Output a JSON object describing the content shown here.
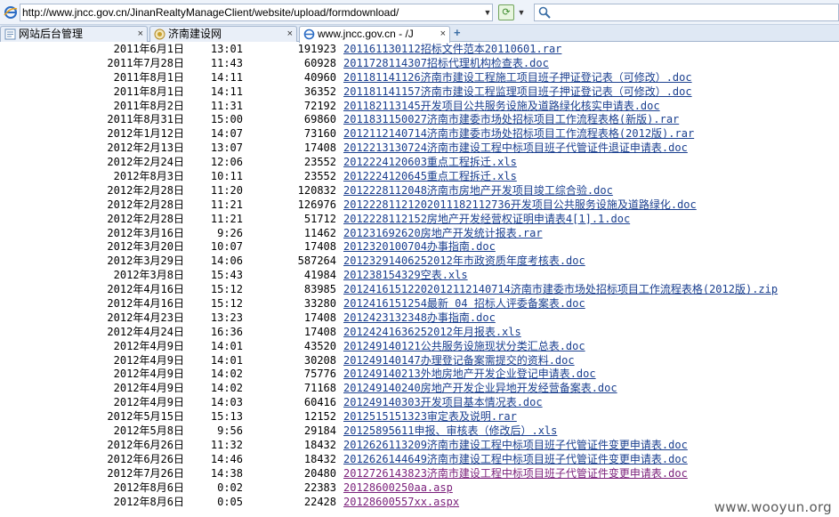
{
  "address_bar": {
    "url": "http://www.jncc.gov.cn/JinanRealtyManageClient/website/upload/formdownload/"
  },
  "tabs": [
    {
      "label": "网站后台管理",
      "close": "×"
    },
    {
      "label": "济南建设网",
      "close": "×"
    },
    {
      "label": "www.jncc.gov.cn - /J",
      "close": "×"
    }
  ],
  "new_tab_label": "+",
  "files": [
    {
      "date": "2011年6月1日",
      "time": "13:01",
      "size": "191923",
      "name": "201161130112招标文件范本20110601.rar"
    },
    {
      "date": "2011年7月28日",
      "time": "11:43",
      "size": "60928",
      "name": "2011728114307招标代理机构检查表.doc"
    },
    {
      "date": "2011年8月1日",
      "time": "14:11",
      "size": "40960",
      "name": "201181141126济南市建设工程施工项目班子押证登记表（可修改）.doc"
    },
    {
      "date": "2011年8月1日",
      "time": "14:11",
      "size": "36352",
      "name": "201181141157济南市建设工程监理项目班子押证登记表（可修改）.doc"
    },
    {
      "date": "2011年8月2日",
      "time": "11:31",
      "size": "72192",
      "name": "201182113145开发项目公共服务设施及道路绿化核实申请表.doc"
    },
    {
      "date": "2011年8月31日",
      "time": "15:00",
      "size": "69860",
      "name": "201183115002​7济南市建委市场处招标项目工作流程表格(新版).rar"
    },
    {
      "date": "2012年1月12日",
      "time": "14:07",
      "size": "73160",
      "name": "201211214071​4济南市建委市场处招标项目工作流程表格(2012版).rar"
    },
    {
      "date": "2012年2月13日",
      "time": "13:07",
      "size": "17408",
      "name": "2012213130724济南市建设工程中标项目班子代管证件退证申请表.doc"
    },
    {
      "date": "2012年2月24日",
      "time": "12:06",
      "size": "23552",
      "name": "2012224120603重点工程拆迁.xls"
    },
    {
      "date": "2012年8月3日",
      "time": "10:11",
      "size": "23552",
      "name": "2012224120645重点工程拆迁.xls"
    },
    {
      "date": "2012年2月28日",
      "time": "11:20",
      "size": "120832",
      "name": "2012228112048济南市房地产开发项目竣工综合验.doc"
    },
    {
      "date": "2012年2月28日",
      "time": "11:21",
      "size": "126976",
      "name": "201222811212020111821127​36开发项目公共服务设施及道路绿化.doc"
    },
    {
      "date": "2012年2月28日",
      "time": "11:21",
      "size": "51712",
      "name": "2012228112152房地产开发经营权证明申请表4[1].1.doc"
    },
    {
      "date": "2012年3月16日",
      "time": "9:26",
      "size": "11462",
      "name": "20123169262​0房地产开发统计报表.rar"
    },
    {
      "date": "2012年3月20日",
      "time": "10:07",
      "size": "17408",
      "name": "2012320100704办事指南.doc"
    },
    {
      "date": "2012年3月29日",
      "time": "14:06",
      "size": "587264",
      "name": "20123291406252012年市政资质年度考核表.doc"
    },
    {
      "date": "2012年3月8日",
      "time": "15:43",
      "size": "41984",
      "name": "20123815432​9空表.xls"
    },
    {
      "date": "2012年4月16日",
      "time": "15:12",
      "size": "83985",
      "name": "2012416151220201211214071​4济南市建委市场处招标项目工作流程表格(2012版).zip"
    },
    {
      "date": "2012年4月16日",
      "time": "15:12",
      "size": "33280",
      "name": "2012416151254最新  04 招标人评委备案表.doc"
    },
    {
      "date": "2012年4月23日",
      "time": "13:23",
      "size": "17408",
      "name": "2012423132348办事指南.doc"
    },
    {
      "date": "2012年4月24日",
      "time": "16:36",
      "size": "17408",
      "name": "20124241636252012年月报表.xls"
    },
    {
      "date": "2012年4月9日",
      "time": "14:01",
      "size": "43520",
      "name": "201249140121公共服务设施现状分类汇总表.doc"
    },
    {
      "date": "2012年4月9日",
      "time": "14:01",
      "size": "30208",
      "name": "201249140147办理登记备案需提交的资料.doc"
    },
    {
      "date": "2012年4月9日",
      "time": "14:02",
      "size": "75776",
      "name": "201249140213外地房地产开发企业登记申请表.doc"
    },
    {
      "date": "2012年4月9日",
      "time": "14:02",
      "size": "71168",
      "name": "201249140240房地产开发企业异地开发经营备案表.doc"
    },
    {
      "date": "2012年4月9日",
      "time": "14:03",
      "size": "60416",
      "name": "201249140303开发项目基本情况表.doc"
    },
    {
      "date": "2012年5月15日",
      "time": "15:13",
      "size": "12152",
      "name": "2012515151323审定表及说明.rar"
    },
    {
      "date": "2012年5月8日",
      "time": "9:56",
      "size": "29184",
      "name": "20125895611申报、审核表（修改后）.xls"
    },
    {
      "date": "2012年6月26日",
      "time": "11:32",
      "size": "18432",
      "name": "2012626113209济南市建设工程中标项目班子代管证件变更申请表.doc"
    },
    {
      "date": "2012年6月26日",
      "time": "14:46",
      "size": "18432",
      "name": "2012626144649济南市建设工程中标项目班子代管证件变更申请表.doc"
    },
    {
      "date": "2012年7月26日",
      "time": "14:38",
      "size": "20480",
      "name": "2012726143823济南市建设工程中标项目班子代管证件变更申请表.doc",
      "visited": true
    },
    {
      "date": "2012年8月6日",
      "time": "0:02",
      "size": "22383",
      "name": "20128600250aa.asp",
      "visited": true
    },
    {
      "date": "2012年8月6日",
      "time": "0:05",
      "size": "22428",
      "name": "20128600557xx.aspx",
      "visited": true
    }
  ],
  "watermark": "www.wooyun.org",
  "colors": {
    "link": "#1a3f8f",
    "visited": "#7a1f7a"
  },
  "icons": {
    "browser": "ie-icon",
    "go": "refresh-go-icon",
    "search": "search-icon"
  }
}
